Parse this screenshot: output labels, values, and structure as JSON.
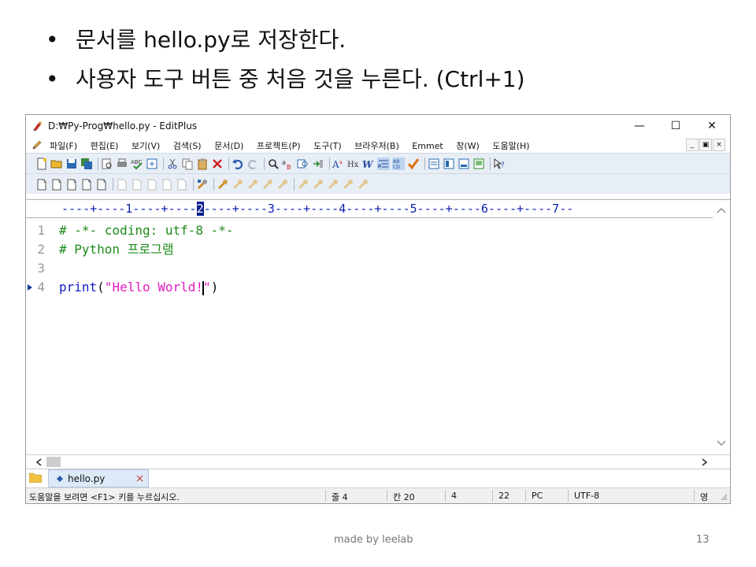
{
  "slide": {
    "bullets": [
      {
        "text": "문서를 hello.py로 저장한다."
      },
      {
        "text": "사용자 도구 버튼 중 처음 것을 누른다. (Ctrl+1)"
      }
    ],
    "footer": "made by leelab",
    "page_number": "13"
  },
  "window": {
    "title": "D:₩Py-Prog₩hello.py - EditPlus",
    "controls": {
      "minimize": "—",
      "maximize": "☐",
      "close": "✕"
    }
  },
  "menu": {
    "items": [
      {
        "label": "파일(F)"
      },
      {
        "label": "편집(E)"
      },
      {
        "label": "보기(V)"
      },
      {
        "label": "검색(S)"
      },
      {
        "label": "문서(D)"
      },
      {
        "label": "프로젝트(P)"
      },
      {
        "label": "도구(T)"
      },
      {
        "label": "브라우저(B)"
      },
      {
        "label": "Emmet"
      },
      {
        "label": "창(W)"
      },
      {
        "label": "도움말(H)"
      }
    ],
    "mdi": {
      "minimize": "_",
      "restore": "▣",
      "close": "×"
    }
  },
  "ruler": {
    "before": "----+----1----+----",
    "cursor": "2",
    "after": "----+----3----+----4----+----5----+----6----+----7--"
  },
  "editor": {
    "lines": [
      {
        "num": "1",
        "text": "# -*- coding: utf-8 -*-"
      },
      {
        "num": "2",
        "text": "# Python 프로그램"
      },
      {
        "num": "3",
        "text": ""
      },
      {
        "num": "4",
        "func": "print",
        "open": "(",
        "str_before": "\"Hello World!",
        "str_after": "\"",
        "close": ")"
      }
    ]
  },
  "tabs": [
    {
      "label": "hello.py"
    }
  ],
  "status": {
    "help": "도움말을 보려면 <F1> 키를 누르십시오.",
    "line": "줄 4",
    "col": "칸 20",
    "val1": "4",
    "val2": "22",
    "eol": "PC",
    "encoding": "UTF-8",
    "ime": "영"
  },
  "colors": {
    "comment": "#1d8a1d",
    "function": "#1218c2",
    "string": "#e21dbd",
    "ruler": "#0b1fb0",
    "toolbar_bg": "#e8eef6"
  }
}
